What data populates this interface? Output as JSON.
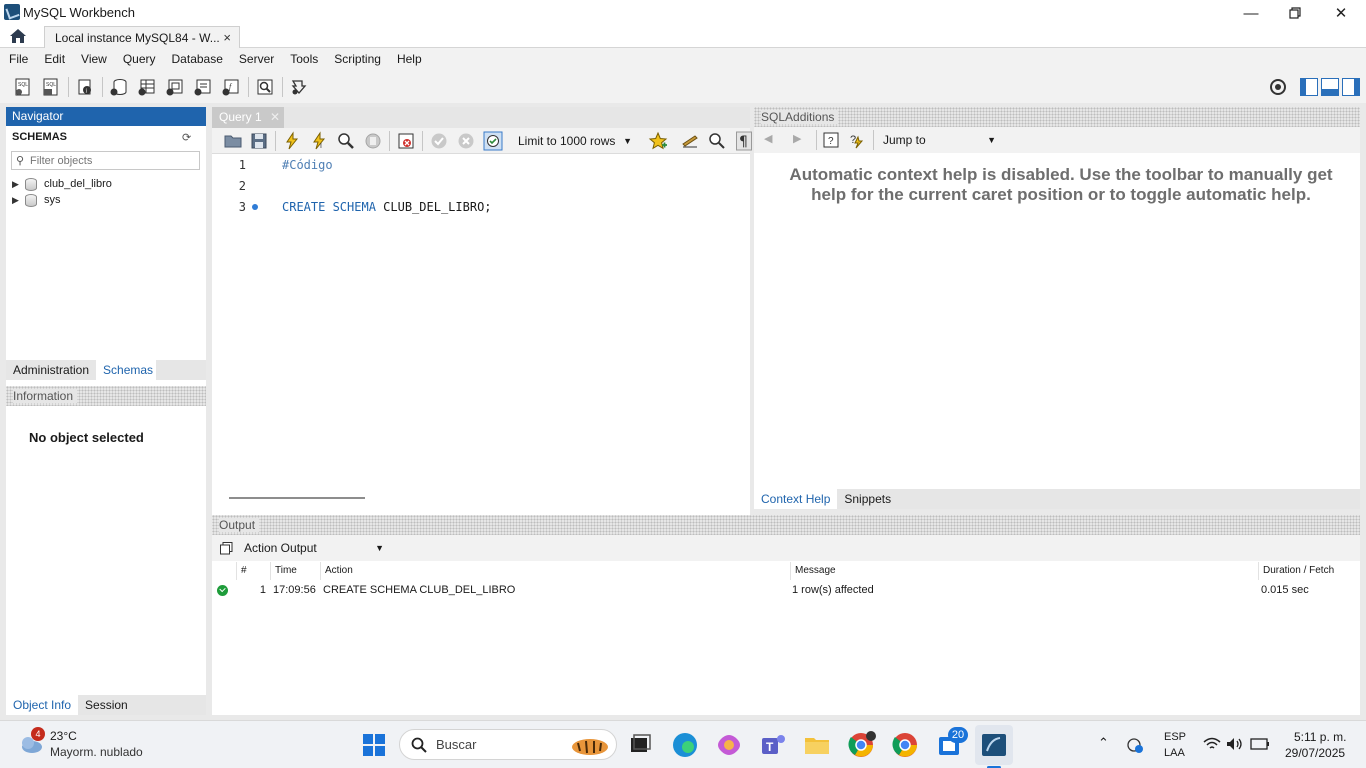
{
  "window": {
    "title": "MySQL Workbench"
  },
  "tabs": {
    "home": "home",
    "document_tab": "Local instance MySQL84 - W...",
    "close": "×"
  },
  "menu": [
    "File",
    "Edit",
    "View",
    "Query",
    "Database",
    "Server",
    "Tools",
    "Scripting",
    "Help"
  ],
  "navigator": {
    "header": "Navigator",
    "schemas_label": "SCHEMAS",
    "filter_placeholder": "Filter objects",
    "schemas": [
      "club_del_libro",
      "sys"
    ],
    "tabs": [
      "Administration",
      "Schemas"
    ],
    "info_header": "Information",
    "no_object": "No object selected",
    "bottom_tabs": [
      "Object Info",
      "Session"
    ]
  },
  "query": {
    "tab_label": "Query 1",
    "limit": "Limit to 1000 rows",
    "lines": [
      {
        "no": "1",
        "text": "#Código"
      },
      {
        "no": "2",
        "text": ""
      },
      {
        "no": "3",
        "kw": "CREATE SCHEMA",
        "rest": " CLUB_DEL_LIBRO;"
      }
    ]
  },
  "sql_additions": {
    "header": "SQLAdditions",
    "jump_to": "Jump to",
    "help_text": "Automatic context help is disabled. Use the toolbar to manually get help for the current caret position or to toggle automatic help.",
    "tabs": [
      "Context Help",
      "Snippets"
    ]
  },
  "output": {
    "header": "Output",
    "mode": "Action Output",
    "columns": [
      "#",
      "Time",
      "Action",
      "Message",
      "Duration / Fetch"
    ],
    "rows": [
      {
        "num": "1",
        "time": "17:09:56",
        "action": "CREATE SCHEMA CLUB_DEL_LIBRO",
        "message": "1 row(s) affected",
        "duration": "0.015 sec"
      }
    ]
  },
  "taskbar": {
    "weather_badge": "4",
    "temperature": "23°C",
    "weather": "Mayorm. nublado",
    "search": "Buscar",
    "teams_badge": "20",
    "lang": "ESP",
    "layout": "LAA",
    "time": "5:11 p. m.",
    "date": "29/07/2025"
  },
  "colors": {
    "accent": "#1f64ad",
    "keyword": "#1f64ad",
    "success": "#1e9c3a"
  }
}
